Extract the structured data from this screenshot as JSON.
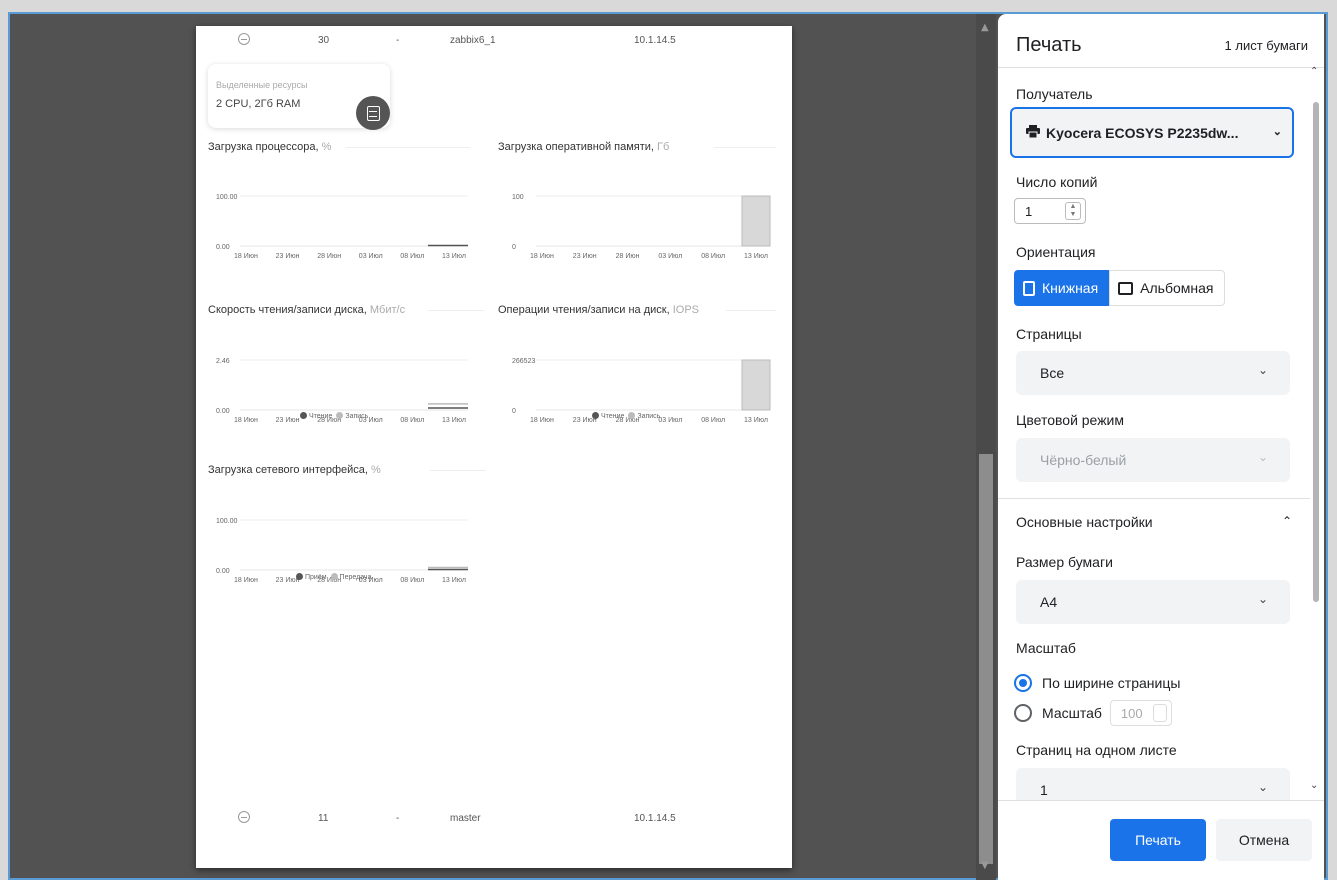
{
  "preview": {
    "top_row": {
      "id": "30",
      "dash": "-",
      "name": "zabbix6_1",
      "ip": "10.1.14.5"
    },
    "bottom_row": {
      "id": "11",
      "dash": "-",
      "name": "master",
      "ip": "10.1.14.5"
    },
    "resources": {
      "caption": "Выделенные ресурсы",
      "value": "2 CPU, 2Гб RAM",
      "icon": "server-icon"
    },
    "charts": [
      {
        "title": "Загрузка процессора,",
        "unit": "%"
      },
      {
        "title": "Загрузка оперативной памяти,",
        "unit": "Гб"
      },
      {
        "title": "Скорость чтения/записи диска,",
        "unit": "Мбит/с"
      },
      {
        "title": "Операции чтения/записи на диск,",
        "unit": "IOPS"
      },
      {
        "title": "Загрузка сетевого интерфейса,",
        "unit": "%"
      }
    ]
  },
  "chart_data": [
    {
      "type": "line",
      "title": "Загрузка процессора, %",
      "x": [
        "18 Июн",
        "23 Июн",
        "28 Июн",
        "03 Июл",
        "08 Июл",
        "13 Июл"
      ],
      "yticks": [
        "100.00",
        "0.00"
      ],
      "ylim": [
        0,
        100
      ],
      "series": [
        {
          "values": [
            null,
            null,
            null,
            null,
            null,
            1
          ]
        }
      ]
    },
    {
      "type": "area",
      "title": "Загрузка оперативной памяти, Гб",
      "x": [
        "18 Июн",
        "23 Июн",
        "28 Июн",
        "03 Июл",
        "08 Июл",
        "13 Июл"
      ],
      "yticks": [
        "100",
        "0"
      ],
      "ylim": [
        0,
        100
      ],
      "series": [
        {
          "values": [
            null,
            null,
            null,
            null,
            null,
            100
          ]
        }
      ]
    },
    {
      "type": "line",
      "title": "Скорость чтения/записи диска, Мбит/с",
      "x": [
        "18 Июн",
        "23 Июн",
        "28 Июн",
        "03 Июл",
        "08 Июл",
        "13 Июл"
      ],
      "yticks": [
        "2.46",
        "0.00"
      ],
      "ylim": [
        0,
        2.46
      ],
      "legend": [
        "Чтение",
        "Запись"
      ],
      "series": [
        {
          "name": "Чтение",
          "values": [
            null,
            null,
            null,
            null,
            null,
            0.1
          ]
        },
        {
          "name": "Запись",
          "values": [
            null,
            null,
            null,
            null,
            null,
            0.2
          ]
        }
      ]
    },
    {
      "type": "area",
      "title": "Операции чтения/записи на диск, IOPS",
      "x": [
        "18 Июн",
        "23 Июн",
        "28 Июн",
        "03 Июл",
        "08 Июл",
        "13 Июл"
      ],
      "yticks": [
        "266523",
        "0"
      ],
      "ylim": [
        0,
        266523
      ],
      "legend": [
        "Чтение",
        "Запись"
      ],
      "series": [
        {
          "name": "Чтение",
          "values": [
            null,
            null,
            null,
            null,
            null,
            266523
          ]
        },
        {
          "name": "Запись",
          "values": [
            null,
            null,
            null,
            null,
            null,
            266523
          ]
        }
      ]
    },
    {
      "type": "line",
      "title": "Загрузка сетевого интерфейса, %",
      "x": [
        "18 Июн",
        "23 Июн",
        "28 Июн",
        "03 Июл",
        "08 Июл",
        "13 Июл"
      ],
      "yticks": [
        "100.00",
        "0.00"
      ],
      "ylim": [
        0,
        100
      ],
      "legend": [
        "Приём",
        "Передача"
      ],
      "series": [
        {
          "name": "Приём",
          "values": [
            null,
            null,
            null,
            null,
            null,
            1
          ]
        },
        {
          "name": "Передача",
          "values": [
            null,
            null,
            null,
            null,
            null,
            1
          ]
        }
      ]
    }
  ],
  "dialog": {
    "title": "Печать",
    "sheets": "1 лист бумаги",
    "destination_label": "Получатель",
    "destination_value": "Kyocera ECOSYS P2235dw...",
    "copies_label": "Число копий",
    "copies_value": "1",
    "orientation_label": "Ориентация",
    "portrait": "Книжная",
    "landscape": "Альбомная",
    "pages_label": "Страницы",
    "pages_value": "Все",
    "color_label": "Цветовой режим",
    "color_value": "Чёрно-белый",
    "advanced": "Основные настройки",
    "paper_label": "Размер бумаги",
    "paper_value": "A4",
    "scale_label": "Масштаб",
    "scale_fit": "По ширине страницы",
    "scale_custom": "Масштаб",
    "scale_value": "100",
    "pps_label": "Страниц на одном листе",
    "pps_value": "1",
    "print_button": "Печать",
    "cancel_button": "Отмена"
  },
  "colors": {
    "accent": "#1a73e8",
    "legend_dark": "#555555",
    "legend_light": "#bbbbbb"
  }
}
